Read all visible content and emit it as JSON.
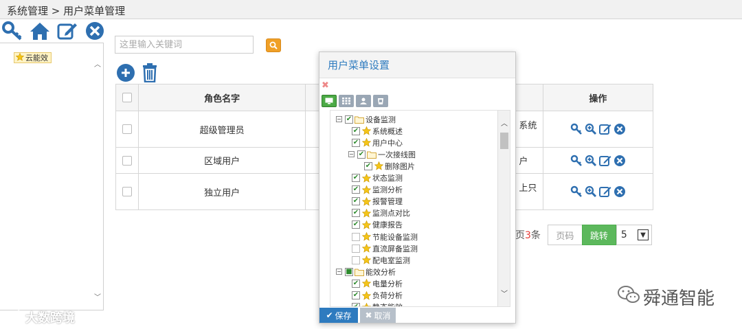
{
  "breadcrumb": "系统管理 > 用户菜单管理",
  "toolbar": {
    "icons": [
      "key-icon",
      "home-icon",
      "edit-icon",
      "close-icon"
    ]
  },
  "left_tree": {
    "root_label": "云能效"
  },
  "search": {
    "placeholder": "这里输入关键词"
  },
  "table": {
    "headers": {
      "name": "角色名字",
      "ops": "操作"
    },
    "rows": [
      {
        "name": "超级管理员",
        "desc": "系统"
      },
      {
        "name": "区域用户",
        "desc": "户"
      },
      {
        "name": "独立用户",
        "desc": "上只"
      }
    ]
  },
  "pager": {
    "total_prefix": "页",
    "total_count": "3",
    "total_suffix": "条",
    "page_placeholder": "页码",
    "jump_label": "跳转",
    "page_size": "5"
  },
  "modal": {
    "title": "用户菜单设置",
    "save_label": "保存",
    "cancel_label": "取消",
    "tree": [
      {
        "label": "设备监测",
        "level": 0,
        "folder": true,
        "checked": true,
        "expanded": true
      },
      {
        "label": "系统概述",
        "level": 1,
        "checked": true
      },
      {
        "label": "用户中心",
        "level": 1,
        "checked": true
      },
      {
        "label": "一次接线图",
        "level": 1,
        "folder": true,
        "checked": true,
        "expanded": true
      },
      {
        "label": "删除图片",
        "level": 2,
        "checked": true
      },
      {
        "label": "状态监测",
        "level": 1,
        "checked": true
      },
      {
        "label": "监测分析",
        "level": 1,
        "checked": true
      },
      {
        "label": "报警管理",
        "level": 1,
        "checked": true
      },
      {
        "label": "监测点对比",
        "level": 1,
        "checked": true
      },
      {
        "label": "健康报告",
        "level": 1,
        "checked": true
      },
      {
        "label": "节能设备监测",
        "level": 1,
        "checked": false
      },
      {
        "label": "直流屏备监测",
        "level": 1,
        "checked": false
      },
      {
        "label": "配电室监测",
        "level": 1,
        "checked": false
      },
      {
        "label": "能效分析",
        "level": 0,
        "folder": true,
        "checked": true,
        "partial": true,
        "expanded": true
      },
      {
        "label": "电量分析",
        "level": 1,
        "checked": true
      },
      {
        "label": "负荷分析",
        "level": 1,
        "checked": true
      },
      {
        "label": "静态能效",
        "level": 1,
        "checked": true
      }
    ]
  },
  "watermarks": {
    "left": "大数跨境",
    "right": "舜通智能"
  },
  "colors": {
    "primary": "#2e7bbf",
    "accent_orange": "#f0a027",
    "success": "#5cb85c",
    "highlight_red": "#e53935"
  }
}
